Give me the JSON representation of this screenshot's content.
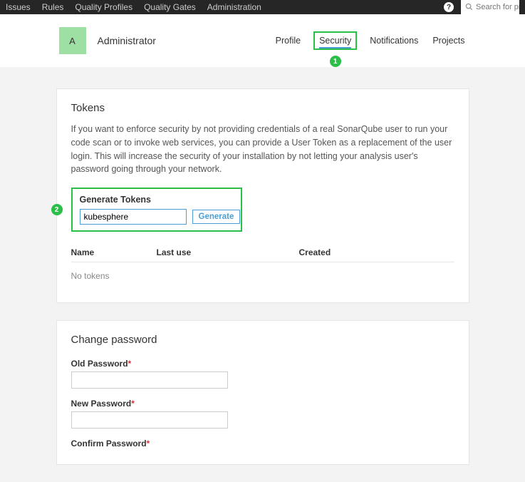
{
  "topnav": {
    "items": [
      "Issues",
      "Rules",
      "Quality Profiles",
      "Quality Gates",
      "Administration"
    ],
    "search_placeholder": "Search for pro"
  },
  "header": {
    "avatar_initial": "A",
    "username": "Administrator",
    "tabs": {
      "profile": "Profile",
      "security": "Security",
      "notifications": "Notifications",
      "projects": "Projects"
    },
    "security_badge": "1"
  },
  "tokens_card": {
    "title": "Tokens",
    "description": "If you want to enforce security by not providing credentials of a real SonarQube user to run your code scan or to invoke web services, you can provide a User Token as a replacement of the user login. This will increase the security of your installation by not letting your analysis user's password going through your network.",
    "generate": {
      "title": "Generate Tokens",
      "input_value": "kubesphere",
      "button": "Generate",
      "badge": "2"
    },
    "table": {
      "col_name": "Name",
      "col_last": "Last use",
      "col_created": "Created",
      "empty": "No tokens"
    }
  },
  "password_card": {
    "title": "Change password",
    "old_label": "Old Password",
    "new_label": "New Password",
    "confirm_label": "Confirm Password",
    "required_mark": "*"
  }
}
